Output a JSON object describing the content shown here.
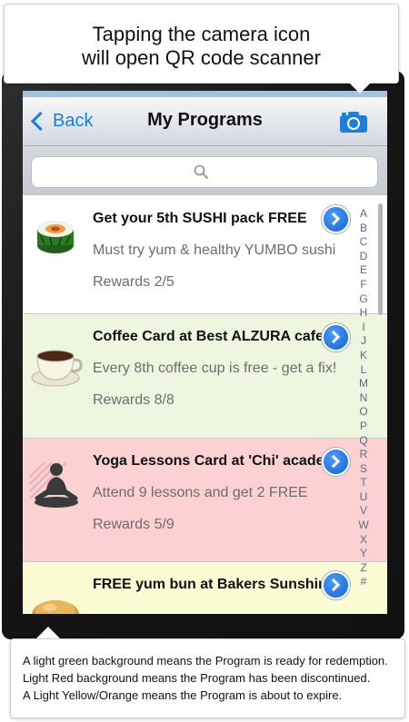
{
  "callouts": {
    "top_line1": "Tapping the camera icon",
    "top_line2": "will open QR code scanner",
    "bottom_line1": "A light green background means the Program is ready for redemption.",
    "bottom_line2": "Light Red background means the Program has been discontinued.",
    "bottom_line3": "A Light Yellow/Orange means the Program is about to expire."
  },
  "navbar": {
    "back_label": "Back",
    "title": "My Programs",
    "camera_icon": "camera-icon"
  },
  "search": {
    "icon": "search-icon"
  },
  "programs": [
    {
      "title": "Get your 5th SUSHI pack FREE",
      "description": "Must try yum & healthy YUMBO sushi",
      "rewards": "Rewards 2/5",
      "status": "active",
      "background": "#ffffff",
      "icon": "sushi-icon"
    },
    {
      "title": "Coffee Card at Best ALZURA cafe",
      "description": "Every 8th coffee cup is free - get a fix!",
      "rewards": "Rewards 8/8",
      "status": "ready",
      "background": "#eef6df",
      "icon": "coffee-cup-icon"
    },
    {
      "title": "Yoga Lessons Card at 'Chi' academy",
      "description": "Attend 9 lessons and get 2 FREE",
      "rewards": "Rewards 5/9",
      "status": "discontinued",
      "background": "#fbd1d1",
      "icon": "yoga-icon"
    },
    {
      "title": "FREE yum bun at Bakers Sunshine",
      "description": "",
      "rewards": "",
      "status": "expiring",
      "background": "#fbfbd4",
      "icon": "bun-icon"
    }
  ],
  "index_letters": [
    "A",
    "B",
    "C",
    "D",
    "E",
    "F",
    "G",
    "H",
    "I",
    "J",
    "K",
    "L",
    "M",
    "N",
    "O",
    "P",
    "Q",
    "R",
    "S",
    "T",
    "U",
    "V",
    "W",
    "X",
    "Y",
    "Z",
    "#"
  ],
  "colors": {
    "accent": "#1a7fe0",
    "ready_bg": "#eef6df",
    "discontinued_bg": "#fbd1d1",
    "expiring_bg": "#fbfbd4"
  }
}
